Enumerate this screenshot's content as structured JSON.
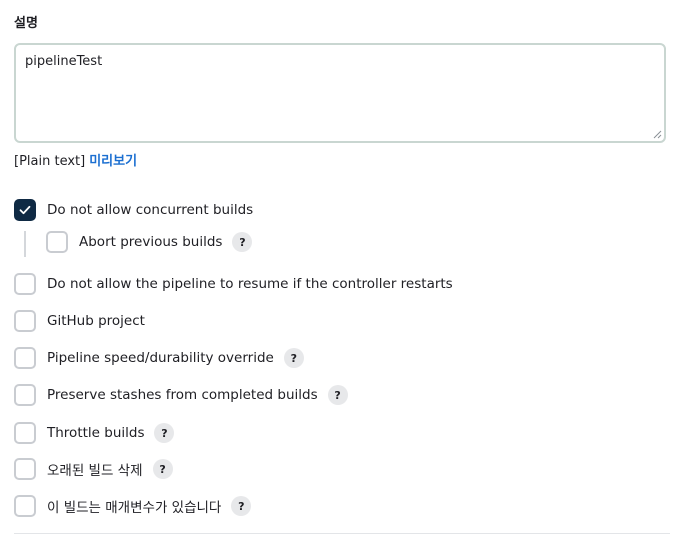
{
  "description": {
    "label": "설명",
    "value": "pipelineTest",
    "format_text": "[Plain text]",
    "preview_link": "미리보기"
  },
  "options": [
    {
      "label": "Do not allow concurrent builds",
      "checked": true,
      "help": false
    },
    {
      "label": "Abort previous builds",
      "checked": false,
      "help": true,
      "nested": true
    },
    {
      "label": "Do not allow the pipeline to resume if the controller restarts",
      "checked": false,
      "help": false
    },
    {
      "label": "GitHub project",
      "checked": false,
      "help": false
    },
    {
      "label": "Pipeline speed/durability override",
      "checked": false,
      "help": true
    },
    {
      "label": "Preserve stashes from completed builds",
      "checked": false,
      "help": true
    },
    {
      "label": "Throttle builds",
      "checked": false,
      "help": true
    },
    {
      "label": "오래된 빌드 삭제",
      "checked": false,
      "help": true
    },
    {
      "label": "이 빌드는 매개변수가 있습니다",
      "checked": false,
      "help": true
    }
  ],
  "help_glyph": "?",
  "icons": {
    "check": "checkmark-icon",
    "help": "help-icon",
    "resize": "resize-grip-icon"
  },
  "colors": {
    "checked_fill": "#0f2a44",
    "link": "#1b6fd1",
    "textarea_border": "#c9d6d1"
  }
}
